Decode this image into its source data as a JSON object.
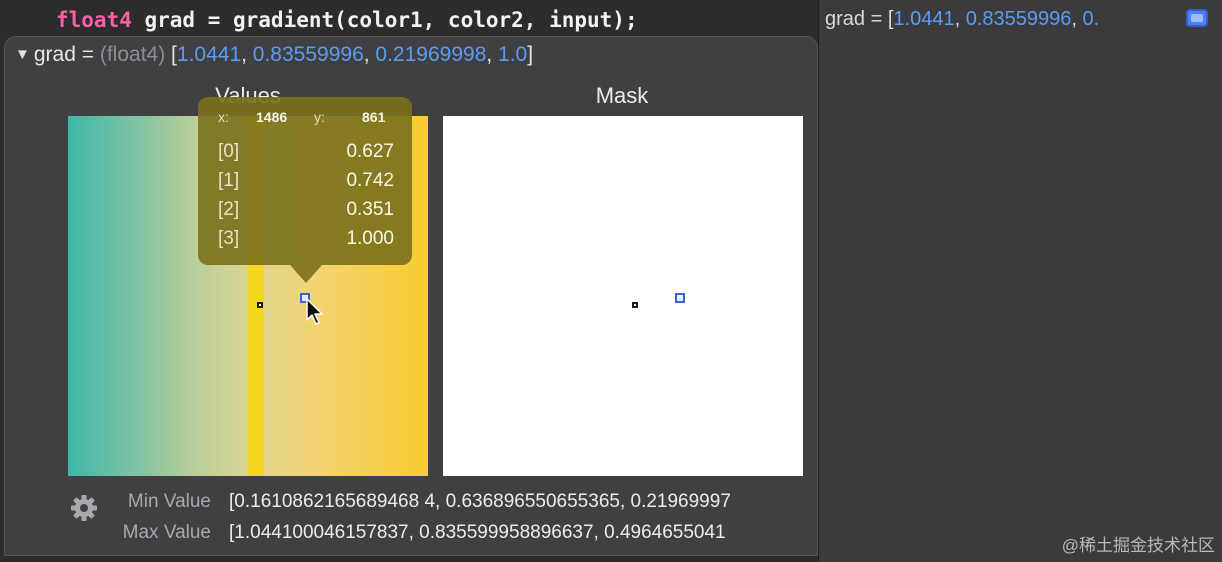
{
  "code": {
    "keyword": "float4",
    "rest": " grad = gradient(color1, color2, input);"
  },
  "sidebar": {
    "prefix": "grad = [",
    "values_visible": [
      "1.0441",
      "0.83559996",
      "0."
    ],
    "sep": ", ",
    "icon": "quicklook-icon"
  },
  "inspector": {
    "var": "grad =",
    "type": "(float4)",
    "open": "[",
    "close": "]",
    "sep": ", ",
    "values": [
      "1.0441",
      "0.83559996",
      "0.21969998",
      "1.0"
    ],
    "values_title": "Values",
    "mask_title": "Mask",
    "tooltip": {
      "x_label": "x:",
      "x": "1486",
      "y_label": "y:",
      "y": "861",
      "rows": [
        {
          "index": "[0]",
          "value": "0.627"
        },
        {
          "index": "[1]",
          "value": "0.742"
        },
        {
          "index": "[2]",
          "value": "0.351"
        },
        {
          "index": "[3]",
          "value": "1.000"
        }
      ]
    },
    "min_label": "Min Value",
    "min_value": "[0.1610862165689468 4, 0.636896550655365, 0.21969997",
    "max_label": "Max Value",
    "max_value": "[1.044100046157837, 0.835599958896637, 0.4964655041"
  },
  "watermark": "@稀土掘金技术社区",
  "colors": {
    "accent_number": "#5b9cf3",
    "keyword": "#fc5fa3",
    "tooltip_bg": "#7a701c"
  }
}
